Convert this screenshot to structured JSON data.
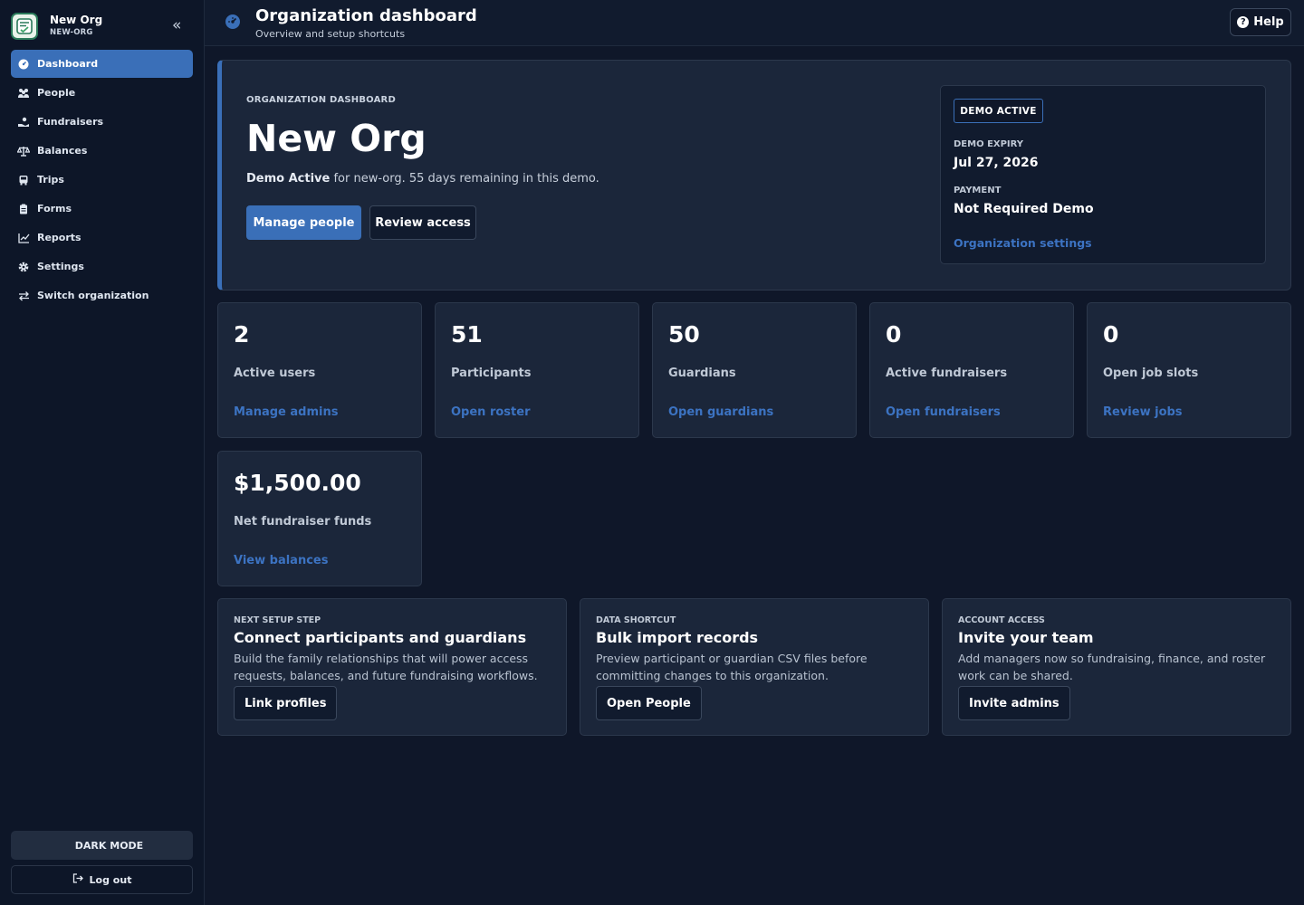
{
  "sidebar": {
    "org_name": "New Org",
    "org_slug": "NEW-ORG",
    "items": [
      {
        "label": "Dashboard",
        "icon": "dashboard-icon"
      },
      {
        "label": "People",
        "icon": "people-icon"
      },
      {
        "label": "Fundraisers",
        "icon": "hand-coin-icon"
      },
      {
        "label": "Balances",
        "icon": "scale-icon"
      },
      {
        "label": "Trips",
        "icon": "bus-icon"
      },
      {
        "label": "Forms",
        "icon": "clipboard-icon"
      },
      {
        "label": "Reports",
        "icon": "chart-line-icon"
      },
      {
        "label": "Settings",
        "icon": "gear-icon"
      },
      {
        "label": "Switch organization",
        "icon": "swap-icon"
      }
    ],
    "active_item": "Dashboard",
    "dark_mode_label": "DARK MODE",
    "logout_label": "Log out"
  },
  "header": {
    "title": "Organization dashboard",
    "subtitle": "Overview and setup shortcuts",
    "help_label": "Help"
  },
  "hero": {
    "kicker": "ORGANIZATION DASHBOARD",
    "title": "New Org",
    "status_bold": "Demo Active",
    "status_rest": " for new-org. 55 days remaining in this demo.",
    "primary_button": "Manage people",
    "secondary_button": "Review access",
    "status_card": {
      "badge": "DEMO ACTIVE",
      "expiry_label": "DEMO EXPIRY",
      "expiry_value": "Jul 27, 2026",
      "payment_label": "PAYMENT",
      "payment_value": "Not Required Demo",
      "settings_link": "Organization settings"
    }
  },
  "stats": [
    {
      "value": "2",
      "label": "Active users",
      "link": "Manage admins"
    },
    {
      "value": "51",
      "label": "Participants",
      "link": "Open roster"
    },
    {
      "value": "50",
      "label": "Guardians",
      "link": "Open guardians"
    },
    {
      "value": "0",
      "label": "Active fundraisers",
      "link": "Open fundraisers"
    },
    {
      "value": "0",
      "label": "Open job slots",
      "link": "Review jobs"
    },
    {
      "value": "$1,500.00",
      "label": "Net fundraiser funds",
      "link": "View balances"
    }
  ],
  "actions": [
    {
      "kicker": "NEXT SETUP STEP",
      "title": "Connect participants and guardians",
      "desc": "Build the family relationships that will power access requests, balances, and future fundraising workflows.",
      "button": "Link profiles"
    },
    {
      "kicker": "DATA SHORTCUT",
      "title": "Bulk import records",
      "desc": "Preview participant or guardian CSV files before committing changes to this organization.",
      "button": "Open People"
    },
    {
      "kicker": "ACCOUNT ACCESS",
      "title": "Invite your team",
      "desc": "Add managers now so fundraising, finance, and roster work can be shared.",
      "button": "Invite admins"
    }
  ],
  "colors": {
    "accent": "#3a6fb8",
    "link": "#3c73c2",
    "background": "#0f1729",
    "card": "#1b263a"
  }
}
